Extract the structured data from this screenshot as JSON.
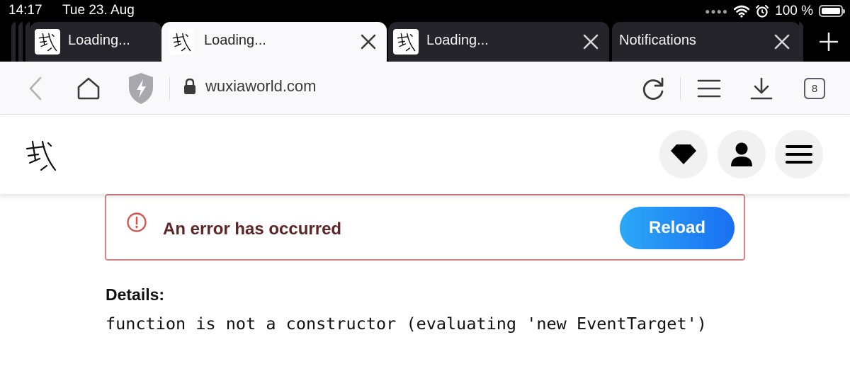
{
  "status_bar": {
    "time": "14:17",
    "date": "Tue 23. Aug",
    "battery_text": "100 %",
    "battery_level": 1.0
  },
  "tabs": [
    {
      "title": "Loading...",
      "favicon": "wuxia-logo-icon",
      "active": false,
      "closable": false
    },
    {
      "title": "Loading...",
      "favicon": "wuxia-logo-icon",
      "active": true,
      "closable": true
    },
    {
      "title": "Loading...",
      "favicon": "wuxia-logo-icon",
      "active": false,
      "closable": true
    },
    {
      "title": "Notifications",
      "favicon": "",
      "active": false,
      "closable": true
    }
  ],
  "toolbar": {
    "url": "wuxiaworld.com",
    "tab_count": "8",
    "icons": [
      "back-arrow-icon",
      "home-icon",
      "shield-icon",
      "lock-icon",
      "reload-icon",
      "menu-icon",
      "download-icon",
      "tab-count-icon"
    ]
  },
  "site_header": {
    "logo": "wuxia-logo-icon",
    "buttons": [
      "diamond-icon",
      "user-icon",
      "hamburger-icon"
    ]
  },
  "error": {
    "message": "An error has occurred",
    "reload_label": "Reload",
    "details_label": "Details:",
    "details_message": "function is not a constructor (evaluating 'new EventTarget')"
  },
  "colors": {
    "error_border": "#d98285",
    "error_text": "#5e2626",
    "reload_gradient_start": "#2ba8f6",
    "reload_gradient_end": "#1a6ff2",
    "tab_active_bg": "#f9f9fb",
    "tab_inactive_bg": "#24242a"
  }
}
